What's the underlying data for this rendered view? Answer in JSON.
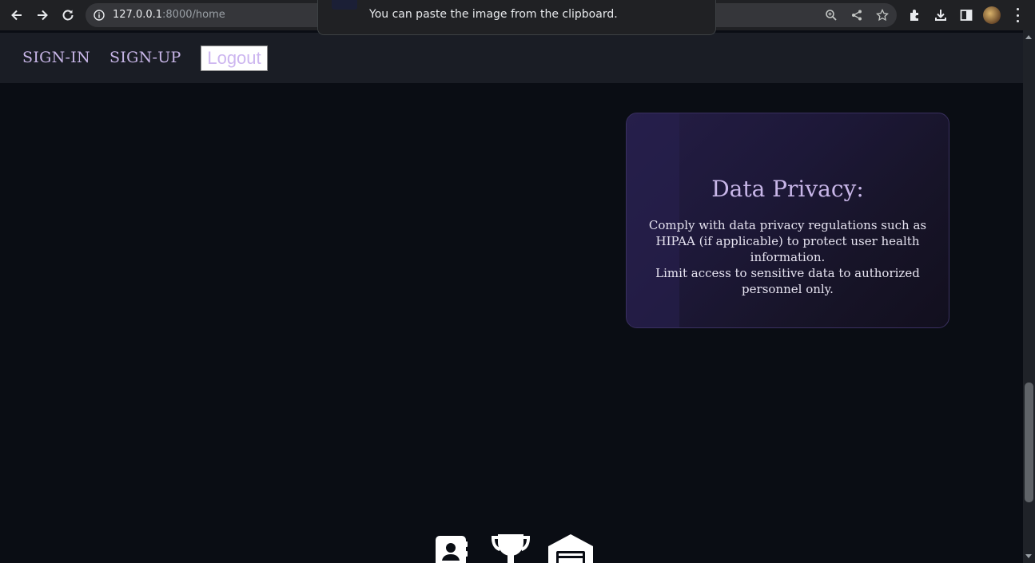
{
  "browser": {
    "url_host": "127.0.0.1",
    "url_path": ":8000/home"
  },
  "paste_popup": {
    "message": "You can paste the image from the clipboard."
  },
  "nav": {
    "sign_in": "SIGN-IN",
    "sign_up": "SIGN-UP",
    "logout": "Logout"
  },
  "privacy_card": {
    "title": "Data Privacy:",
    "line1": "Comply with data privacy regulations such as HIPAA (if applicable) to protect user health information.",
    "line2": "Limit access to sensitive data to authorized personnel only."
  },
  "footer_icons": [
    "contact-book-icon",
    "trophy-icon",
    "card-icon"
  ]
}
